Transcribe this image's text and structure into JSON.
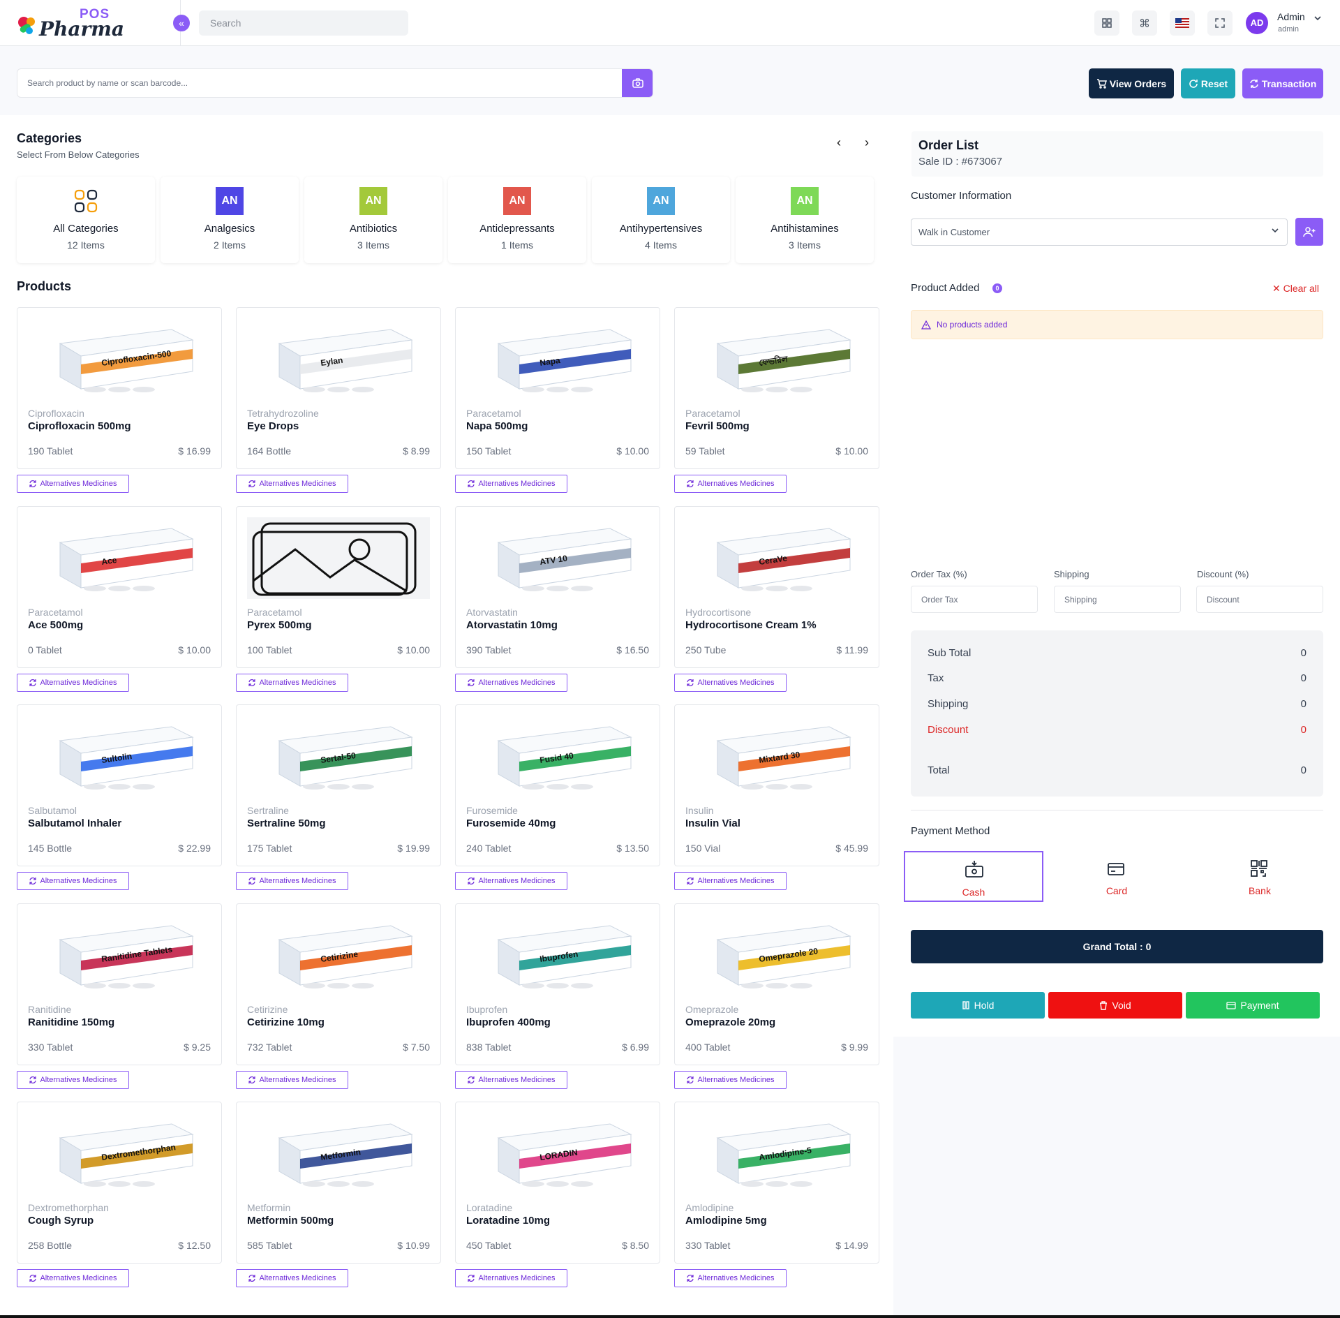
{
  "header": {
    "logo_pos": "POS",
    "logo_pharma": "Pharma",
    "search_placeholder": "Search",
    "user_initials": "AD",
    "user_name": "Admin",
    "user_role": "admin",
    "icons": [
      "grid-icon",
      "command-icon",
      "us-flag-icon",
      "fullscreen-icon",
      "chevron-down-icon"
    ]
  },
  "toolbar": {
    "product_search_placeholder": "Search product by name or scan barcode...",
    "view_orders": "View Orders",
    "reset": "Reset",
    "transaction": "Transaction"
  },
  "colors": {
    "accent": "#8b5cf6",
    "navy": "#0f2744",
    "teal": "#1ea7b7",
    "red": "#dc2626",
    "green": "#22c55e"
  },
  "categories": {
    "title": "Categories",
    "subtitle": "Select From Below Categories",
    "items": [
      {
        "name": "All Categories",
        "count": "12 Items",
        "badge": "",
        "color": ""
      },
      {
        "name": "Analgesics",
        "count": "2 Items",
        "badge": "AN",
        "color": "#4f46e5"
      },
      {
        "name": "Antibiotics",
        "count": "3 Items",
        "badge": "AN",
        "color": "#a3c93a"
      },
      {
        "name": "Antidepressants",
        "count": "1 Items",
        "badge": "AN",
        "color": "#e2574c"
      },
      {
        "name": "Antihypertensives",
        "count": "4 Items",
        "badge": "AN",
        "color": "#4ea6dc"
      },
      {
        "name": "Antihistamines",
        "count": "3 Items",
        "badge": "AN",
        "color": "#7ed957"
      }
    ]
  },
  "products": {
    "title": "Products",
    "alt_label": "Alternatives Medicines",
    "items": [
      {
        "generic": "Ciprofloxacin",
        "name": "Ciprofloxacin 500mg",
        "stock": "190 Tablet",
        "price": "$ 16.99",
        "box": "#f08a1c",
        "box_text": "Ciprofloxacin-500"
      },
      {
        "generic": "Tetrahydrozoline",
        "name": "Eye Drops",
        "stock": "164 Bottle",
        "price": "$ 8.99",
        "box": "#e5e7eb",
        "box_text": "Eylan"
      },
      {
        "generic": "Paracetamol",
        "name": "Napa 500mg",
        "stock": "150 Tablet",
        "price": "$ 10.00",
        "box": "#1e40af",
        "box_text": "Napa"
      },
      {
        "generic": "Paracetamol",
        "name": "Fevril 500mg",
        "stock": "59 Tablet",
        "price": "$ 10.00",
        "box": "#3f6212",
        "box_text": "ফেভরিল"
      },
      {
        "generic": "Paracetamol",
        "name": "Ace 500mg",
        "stock": "0 Tablet",
        "price": "$ 10.00",
        "box": "#dc2626",
        "box_text": "Ace"
      },
      {
        "generic": "Paracetamol",
        "name": "Pyrex 500mg",
        "stock": "100 Tablet",
        "price": "$ 10.00",
        "box": "",
        "box_text": ""
      },
      {
        "generic": "Atorvastatin",
        "name": "Atorvastatin 10mg",
        "stock": "390 Tablet",
        "price": "$ 16.50",
        "box": "#94a3b8",
        "box_text": "ATV 10"
      },
      {
        "generic": "Hydrocortisone",
        "name": "Hydrocortisone Cream 1%",
        "stock": "250 Tube",
        "price": "$ 11.99",
        "box": "#b91c1c",
        "box_text": "CeraVe"
      },
      {
        "generic": "Salbutamol",
        "name": "Salbutamol Inhaler",
        "stock": "145 Bottle",
        "price": "$ 22.99",
        "box": "#2563eb",
        "box_text": "Sultolin"
      },
      {
        "generic": "Sertraline",
        "name": "Sertraline 50mg",
        "stock": "175 Tablet",
        "price": "$ 19.99",
        "box": "#15803d",
        "box_text": "Sertal-50"
      },
      {
        "generic": "Furosemide",
        "name": "Furosemide 40mg",
        "stock": "240 Tablet",
        "price": "$ 13.50",
        "box": "#16a34a",
        "box_text": "Fusid 40"
      },
      {
        "generic": "Insulin",
        "name": "Insulin Vial",
        "stock": "150 Vial",
        "price": "$ 45.99",
        "box": "#ea580c",
        "box_text": "Mixtard 30"
      },
      {
        "generic": "Ranitidine",
        "name": "Ranitidine 150mg",
        "stock": "330 Tablet",
        "price": "$ 9.25",
        "box": "#be123c",
        "box_text": "Ranitidine Tablets"
      },
      {
        "generic": "Cetirizine",
        "name": "Cetirizine 10mg",
        "stock": "732 Tablet",
        "price": "$ 7.50",
        "box": "#ea580c",
        "box_text": "Cetirizine"
      },
      {
        "generic": "Ibuprofen",
        "name": "Ibuprofen 400mg",
        "stock": "838 Tablet",
        "price": "$ 6.99",
        "box": "#0d9488",
        "box_text": "Ibuprofen"
      },
      {
        "generic": "Omeprazole",
        "name": "Omeprazole 20mg",
        "stock": "400 Tablet",
        "price": "$ 9.99",
        "box": "#eab308",
        "box_text": "Omeprazole 20"
      },
      {
        "generic": "Dextromethorphan",
        "name": "Cough Syrup",
        "stock": "258 Bottle",
        "price": "$ 12.50",
        "box": "#ca8a04",
        "box_text": "Dextromethorphan"
      },
      {
        "generic": "Metformin",
        "name": "Metformin 500mg",
        "stock": "585 Tablet",
        "price": "$ 10.99",
        "box": "#1e3a8a",
        "box_text": "Metformin"
      },
      {
        "generic": "Loratadine",
        "name": "Loratadine 10mg",
        "stock": "450 Tablet",
        "price": "$ 8.50",
        "box": "#db2777",
        "box_text": "LORADIN"
      },
      {
        "generic": "Amlodipine",
        "name": "Amlodipine 5mg",
        "stock": "330 Tablet",
        "price": "$ 14.99",
        "box": "#16a34a",
        "box_text": "Amlodipine-5"
      }
    ]
  },
  "order": {
    "title": "Order List",
    "sale_id": "Sale ID : #673067",
    "customer_label": "Customer Information",
    "customer_value": "Walk in Customer",
    "added_label": "Product Added",
    "added_count": "0",
    "clear_all": "Clear all",
    "no_products": "No products added",
    "tax_label": "Order Tax (%)",
    "tax_placeholder": "Order Tax",
    "shipping_label": "Shipping",
    "shipping_placeholder": "Shipping",
    "discount_label": "Discount (%)",
    "discount_placeholder": "Discount",
    "totals": [
      {
        "label": "Sub Total",
        "value": "0"
      },
      {
        "label": "Tax",
        "value": "0"
      },
      {
        "label": "Shipping",
        "value": "0"
      },
      {
        "label": "Discount",
        "value": "0"
      },
      {
        "label": "Total",
        "value": "0"
      }
    ],
    "payment_label": "Payment Method",
    "methods": [
      "Cash",
      "Card",
      "Bank"
    ],
    "grand_total": "Grand Total : 0",
    "hold": "Hold",
    "void": "Void",
    "payment": "Payment"
  }
}
